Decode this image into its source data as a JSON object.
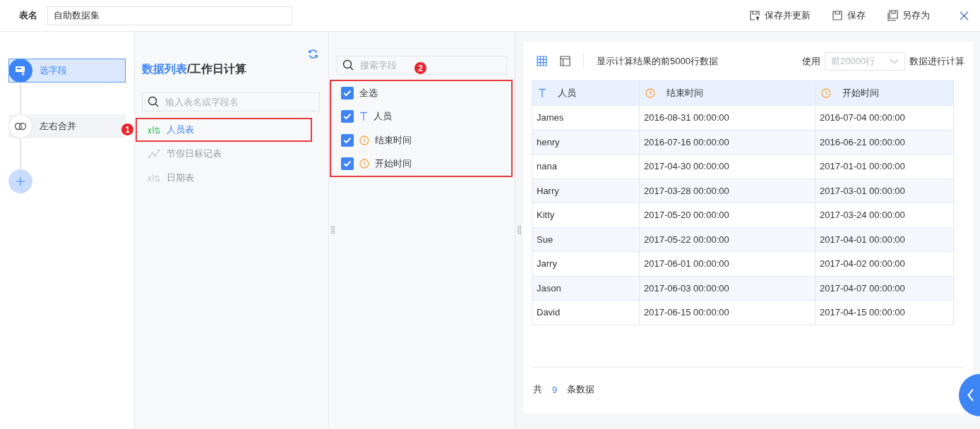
{
  "header": {
    "name_label": "表名",
    "name_value": "自助数据集",
    "actions": [
      {
        "label": "保存并更新",
        "kind": "save-update"
      },
      {
        "label": "保存",
        "kind": "save"
      },
      {
        "label": "另存为",
        "kind": "save-as"
      }
    ]
  },
  "steps": [
    {
      "label": "选字段",
      "kind": "select",
      "selected": true
    },
    {
      "label": "左右合并",
      "kind": "merge",
      "selected": false
    }
  ],
  "tables_panel": {
    "title_link": "数据列表",
    "title_rest": "/工作日计算",
    "search": {
      "placeholder": "输入表名或字段名"
    },
    "items": [
      {
        "label": "人员表",
        "kind": "xls",
        "disabled": false,
        "annotation": "1"
      },
      {
        "label": "节假日标记表",
        "kind": "chart",
        "disabled": true
      },
      {
        "label": "日期表",
        "kind": "xls",
        "disabled": true
      }
    ]
  },
  "fields_panel": {
    "search": {
      "placeholder": "搜索字段"
    },
    "annotation": "2",
    "items": [
      {
        "label": "全选",
        "kind": "all",
        "checked": true
      },
      {
        "label": "人员",
        "kind": "text",
        "checked": true
      },
      {
        "label": "结束时间",
        "kind": "time",
        "checked": true
      },
      {
        "label": "开始时间",
        "kind": "time",
        "checked": true
      }
    ]
  },
  "preview": {
    "note": "显示计算结果的前5000行数据",
    "use_label": "使用",
    "rows_select": "前20000行",
    "after_label": "数据进行计算",
    "columns": [
      {
        "label": "人员",
        "kind": "text"
      },
      {
        "label": "结束时间",
        "kind": "time"
      },
      {
        "label": "开始时间",
        "kind": "time"
      }
    ],
    "rows": [
      [
        "James",
        "2016-08-31 00:00:00",
        "2016-07-04 00:00:00"
      ],
      [
        "henry",
        "2016-07-16 00:00:00",
        "2016-06-21 00:00:00"
      ],
      [
        "nana",
        "2017-04-30 00:00:00",
        "2017-01-01 00:00:00"
      ],
      [
        "Harry",
        "2017-03-28 00:00:00",
        "2017-03-01 00:00:00"
      ],
      [
        "Kitty",
        "2017-05-20 00:00:00",
        "2017-03-24 00:00:00"
      ],
      [
        "Sue",
        "2017-05-22 00:00:00",
        "2017-04-01 00:00:00"
      ],
      [
        "Jarry",
        "2017-06-01 00:00:00",
        "2017-04-02 00:00:00"
      ],
      [
        "Jason",
        "2017-06-03 00:00:00",
        "2017-04-07 00:00:00"
      ],
      [
        "David",
        "2017-06-15 00:00:00",
        "2017-04-15 00:00:00"
      ]
    ],
    "footer": {
      "prefix": "共",
      "count": "9",
      "suffix": "条数据"
    }
  }
}
